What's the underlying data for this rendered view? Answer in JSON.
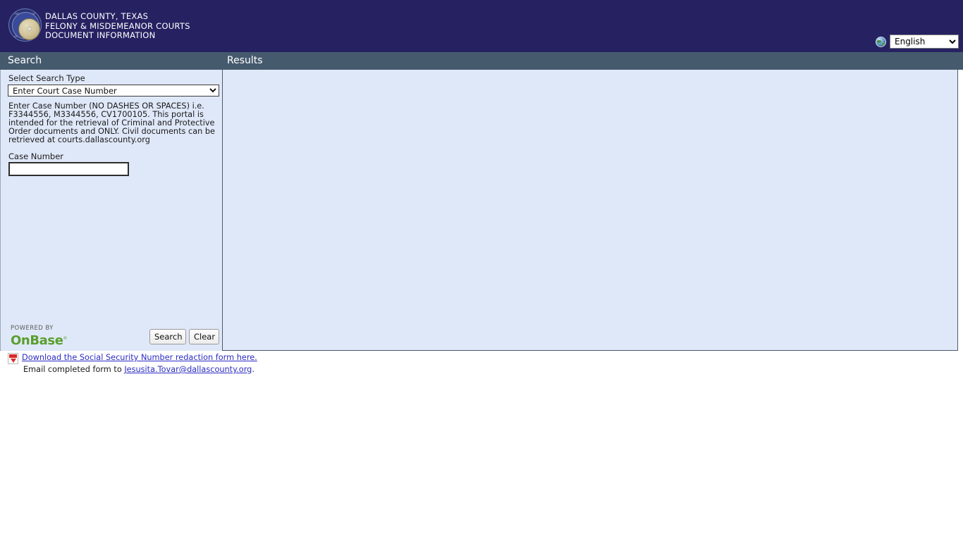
{
  "header": {
    "seal": {
      "icon": "dallas-county-seal",
      "ring_text_top": "THE COUNTY OF DALLAS",
      "ring_text_bottom": "STATE OF TEXAS"
    },
    "title_lines": [
      "DALLAS COUNTY, TEXAS",
      "FELONY & MISDEMEANOR COURTS",
      "DOCUMENT INFORMATION"
    ],
    "language": {
      "icon": "globe-icon",
      "selected": "English",
      "options": [
        "English"
      ]
    },
    "colors": {
      "background": "#262262",
      "text": "#ffffff"
    }
  },
  "section_bar": {
    "search_label": "Search",
    "results_label": "Results",
    "background": "#465a6e"
  },
  "search_panel": {
    "search_type_label": "Select Search Type",
    "search_type_selected": "Enter Court Case Number",
    "search_type_options": [
      "Enter Court Case Number"
    ],
    "instructions": "Enter Case Number (NO DASHES OR SPACES) i.e. F3344556, M3344556, CV1700105. This portal is intended for the retrieval of Criminal and Protective Order documents and ONLY. Civil documents can be retrieved at courts.dallascounty.org",
    "case_number_label": "Case Number",
    "case_number_value": "",
    "case_number_placeholder": "",
    "buttons": {
      "search": "Search",
      "clear": "Clear"
    },
    "branding": {
      "powered_by": "POWERED BY",
      "product": "OnBase",
      "registered_mark": "®",
      "color": "#5a9e2f"
    },
    "background": "#dfe8f8"
  },
  "results_panel": {
    "content": "",
    "background": "#dfe8f8"
  },
  "footer": {
    "pdf_icon": "pdf-file-icon",
    "download_link": "Download the Social Security Number redaction form here.",
    "email_prefix": "Email completed form to ",
    "email_link": "Jesusita.Tovar@dallascounty.org",
    "email_suffix": ".",
    "link_color": "#2b2bc4"
  }
}
